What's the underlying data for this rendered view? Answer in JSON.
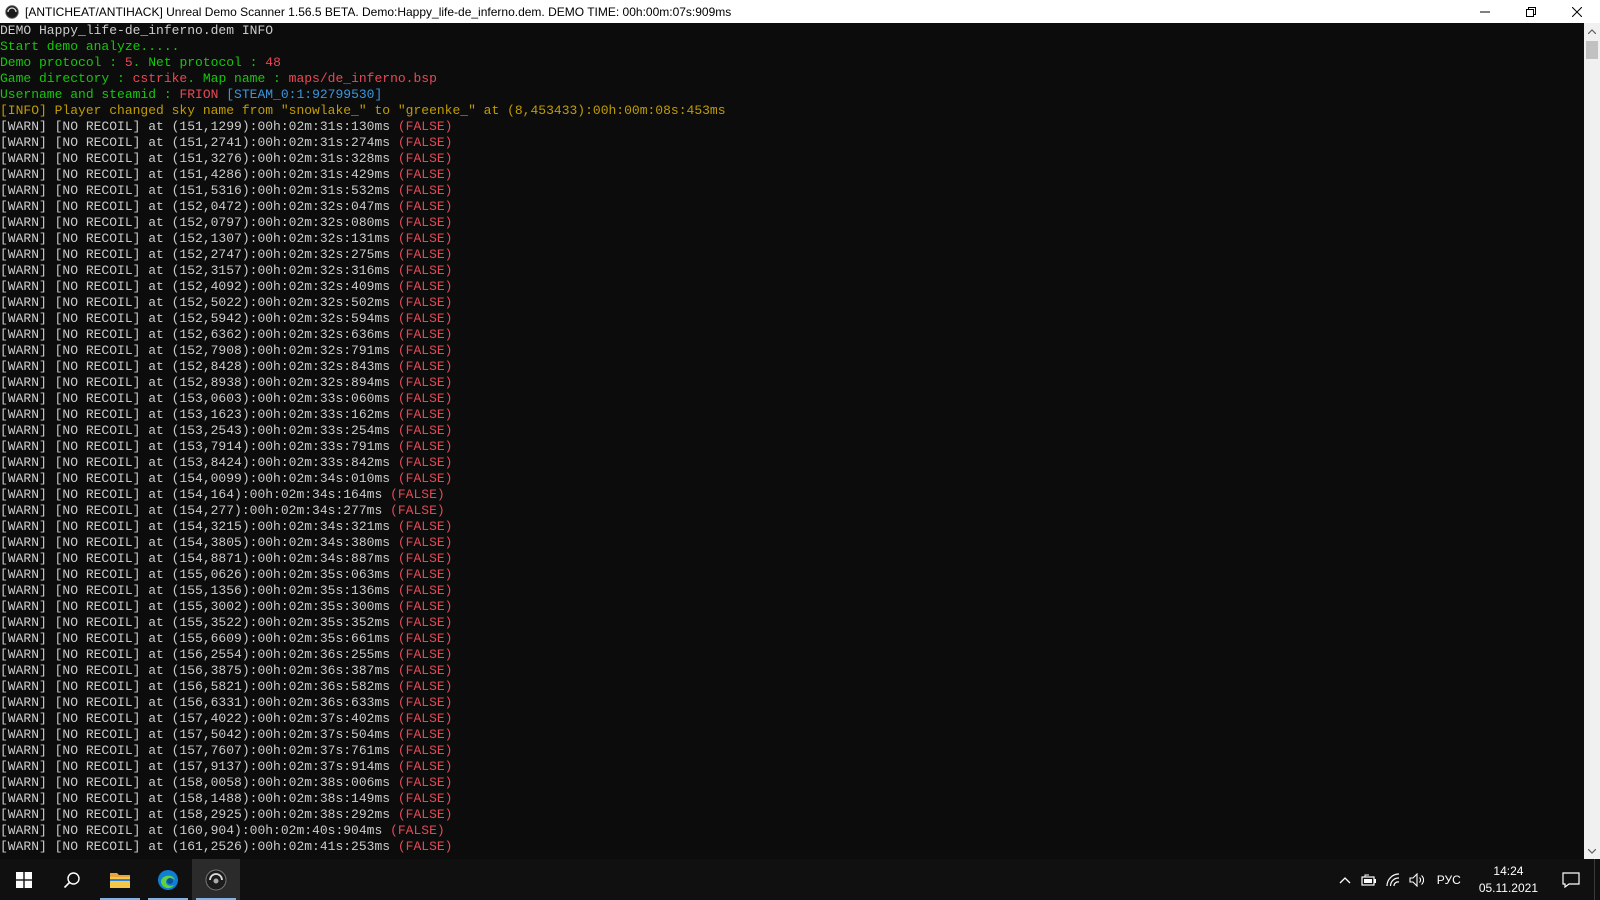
{
  "window": {
    "title": "[ANTICHEAT/ANTIHACK] Unreal Demo Scanner 1.56.5 BETA. Demo:Happy_life-de_inferno.dem. DEMO TIME: 00h:00m:07s:909ms"
  },
  "colors": {
    "gray": "#cccccc",
    "green": "#16c60c",
    "red": "#e74856",
    "cyan": "#3a96dd",
    "yellow": "#c19c00",
    "console_bg": "#0c0c0c"
  },
  "console": {
    "lines": [
      [
        {
          "t": "DEMO Happy_life-de_inferno.dem INFO",
          "c": "gray"
        }
      ],
      [
        {
          "t": "Start demo analyze.....",
          "c": "green"
        }
      ],
      [
        {
          "t": "Demo protocol : ",
          "c": "green"
        },
        {
          "t": "5",
          "c": "red"
        },
        {
          "t": ". Net protocol : ",
          "c": "green"
        },
        {
          "t": "48",
          "c": "red"
        }
      ],
      [
        {
          "t": "Game directory : ",
          "c": "green"
        },
        {
          "t": "cstrike",
          "c": "red"
        },
        {
          "t": ". Map name : ",
          "c": "green"
        },
        {
          "t": "maps/de_inferno.bsp",
          "c": "red"
        }
      ],
      [
        {
          "t": "Username and steamid : ",
          "c": "green"
        },
        {
          "t": "FRION",
          "c": "red"
        },
        {
          "t": " [STEAM_0:1:92799530]",
          "c": "cyan"
        }
      ],
      [
        {
          "t": "[INFO] Player changed sky name from \"snowlake_\" to \"greenke_\" at (8,453433):00h:00m:08s:453ms",
          "c": "yellow"
        }
      ],
      [
        {
          "t": "[WARN] [NO RECOIL] at (151,1299):00h:02m:31s:130ms ",
          "c": "gray"
        },
        {
          "t": "(FALSE)",
          "c": "red"
        }
      ],
      [
        {
          "t": "[WARN] [NO RECOIL] at (151,2741):00h:02m:31s:274ms ",
          "c": "gray"
        },
        {
          "t": "(FALSE)",
          "c": "red"
        }
      ],
      [
        {
          "t": "[WARN] [NO RECOIL] at (151,3276):00h:02m:31s:328ms ",
          "c": "gray"
        },
        {
          "t": "(FALSE)",
          "c": "red"
        }
      ],
      [
        {
          "t": "[WARN] [NO RECOIL] at (151,4286):00h:02m:31s:429ms ",
          "c": "gray"
        },
        {
          "t": "(FALSE)",
          "c": "red"
        }
      ],
      [
        {
          "t": "[WARN] [NO RECOIL] at (151,5316):00h:02m:31s:532ms ",
          "c": "gray"
        },
        {
          "t": "(FALSE)",
          "c": "red"
        }
      ],
      [
        {
          "t": "[WARN] [NO RECOIL] at (152,0472):00h:02m:32s:047ms ",
          "c": "gray"
        },
        {
          "t": "(FALSE)",
          "c": "red"
        }
      ],
      [
        {
          "t": "[WARN] [NO RECOIL] at (152,0797):00h:02m:32s:080ms ",
          "c": "gray"
        },
        {
          "t": "(FALSE)",
          "c": "red"
        }
      ],
      [
        {
          "t": "[WARN] [NO RECOIL] at (152,1307):00h:02m:32s:131ms ",
          "c": "gray"
        },
        {
          "t": "(FALSE)",
          "c": "red"
        }
      ],
      [
        {
          "t": "[WARN] [NO RECOIL] at (152,2747):00h:02m:32s:275ms ",
          "c": "gray"
        },
        {
          "t": "(FALSE)",
          "c": "red"
        }
      ],
      [
        {
          "t": "[WARN] [NO RECOIL] at (152,3157):00h:02m:32s:316ms ",
          "c": "gray"
        },
        {
          "t": "(FALSE)",
          "c": "red"
        }
      ],
      [
        {
          "t": "[WARN] [NO RECOIL] at (152,4092):00h:02m:32s:409ms ",
          "c": "gray"
        },
        {
          "t": "(FALSE)",
          "c": "red"
        }
      ],
      [
        {
          "t": "[WARN] [NO RECOIL] at (152,5022):00h:02m:32s:502ms ",
          "c": "gray"
        },
        {
          "t": "(FALSE)",
          "c": "red"
        }
      ],
      [
        {
          "t": "[WARN] [NO RECOIL] at (152,5942):00h:02m:32s:594ms ",
          "c": "gray"
        },
        {
          "t": "(FALSE)",
          "c": "red"
        }
      ],
      [
        {
          "t": "[WARN] [NO RECOIL] at (152,6362):00h:02m:32s:636ms ",
          "c": "gray"
        },
        {
          "t": "(FALSE)",
          "c": "red"
        }
      ],
      [
        {
          "t": "[WARN] [NO RECOIL] at (152,7908):00h:02m:32s:791ms ",
          "c": "gray"
        },
        {
          "t": "(FALSE)",
          "c": "red"
        }
      ],
      [
        {
          "t": "[WARN] [NO RECOIL] at (152,8428):00h:02m:32s:843ms ",
          "c": "gray"
        },
        {
          "t": "(FALSE)",
          "c": "red"
        }
      ],
      [
        {
          "t": "[WARN] [NO RECOIL] at (152,8938):00h:02m:32s:894ms ",
          "c": "gray"
        },
        {
          "t": "(FALSE)",
          "c": "red"
        }
      ],
      [
        {
          "t": "[WARN] [NO RECOIL] at (153,0603):00h:02m:33s:060ms ",
          "c": "gray"
        },
        {
          "t": "(FALSE)",
          "c": "red"
        }
      ],
      [
        {
          "t": "[WARN] [NO RECOIL] at (153,1623):00h:02m:33s:162ms ",
          "c": "gray"
        },
        {
          "t": "(FALSE)",
          "c": "red"
        }
      ],
      [
        {
          "t": "[WARN] [NO RECOIL] at (153,2543):00h:02m:33s:254ms ",
          "c": "gray"
        },
        {
          "t": "(FALSE)",
          "c": "red"
        }
      ],
      [
        {
          "t": "[WARN] [NO RECOIL] at (153,7914):00h:02m:33s:791ms ",
          "c": "gray"
        },
        {
          "t": "(FALSE)",
          "c": "red"
        }
      ],
      [
        {
          "t": "[WARN] [NO RECOIL] at (153,8424):00h:02m:33s:842ms ",
          "c": "gray"
        },
        {
          "t": "(FALSE)",
          "c": "red"
        }
      ],
      [
        {
          "t": "[WARN] [NO RECOIL] at (154,0099):00h:02m:34s:010ms ",
          "c": "gray"
        },
        {
          "t": "(FALSE)",
          "c": "red"
        }
      ],
      [
        {
          "t": "[WARN] [NO RECOIL] at (154,164):00h:02m:34s:164ms ",
          "c": "gray"
        },
        {
          "t": "(FALSE)",
          "c": "red"
        }
      ],
      [
        {
          "t": "[WARN] [NO RECOIL] at (154,277):00h:02m:34s:277ms ",
          "c": "gray"
        },
        {
          "t": "(FALSE)",
          "c": "red"
        }
      ],
      [
        {
          "t": "[WARN] [NO RECOIL] at (154,3215):00h:02m:34s:321ms ",
          "c": "gray"
        },
        {
          "t": "(FALSE)",
          "c": "red"
        }
      ],
      [
        {
          "t": "[WARN] [NO RECOIL] at (154,3805):00h:02m:34s:380ms ",
          "c": "gray"
        },
        {
          "t": "(FALSE)",
          "c": "red"
        }
      ],
      [
        {
          "t": "[WARN] [NO RECOIL] at (154,8871):00h:02m:34s:887ms ",
          "c": "gray"
        },
        {
          "t": "(FALSE)",
          "c": "red"
        }
      ],
      [
        {
          "t": "[WARN] [NO RECOIL] at (155,0626):00h:02m:35s:063ms ",
          "c": "gray"
        },
        {
          "t": "(FALSE)",
          "c": "red"
        }
      ],
      [
        {
          "t": "[WARN] [NO RECOIL] at (155,1356):00h:02m:35s:136ms ",
          "c": "gray"
        },
        {
          "t": "(FALSE)",
          "c": "red"
        }
      ],
      [
        {
          "t": "[WARN] [NO RECOIL] at (155,3002):00h:02m:35s:300ms ",
          "c": "gray"
        },
        {
          "t": "(FALSE)",
          "c": "red"
        }
      ],
      [
        {
          "t": "[WARN] [NO RECOIL] at (155,3522):00h:02m:35s:352ms ",
          "c": "gray"
        },
        {
          "t": "(FALSE)",
          "c": "red"
        }
      ],
      [
        {
          "t": "[WARN] [NO RECOIL] at (155,6609):00h:02m:35s:661ms ",
          "c": "gray"
        },
        {
          "t": "(FALSE)",
          "c": "red"
        }
      ],
      [
        {
          "t": "[WARN] [NO RECOIL] at (156,2554):00h:02m:36s:255ms ",
          "c": "gray"
        },
        {
          "t": "(FALSE)",
          "c": "red"
        }
      ],
      [
        {
          "t": "[WARN] [NO RECOIL] at (156,3875):00h:02m:36s:387ms ",
          "c": "gray"
        },
        {
          "t": "(FALSE)",
          "c": "red"
        }
      ],
      [
        {
          "t": "[WARN] [NO RECOIL] at (156,5821):00h:02m:36s:582ms ",
          "c": "gray"
        },
        {
          "t": "(FALSE)",
          "c": "red"
        }
      ],
      [
        {
          "t": "[WARN] [NO RECOIL] at (156,6331):00h:02m:36s:633ms ",
          "c": "gray"
        },
        {
          "t": "(FALSE)",
          "c": "red"
        }
      ],
      [
        {
          "t": "[WARN] [NO RECOIL] at (157,4022):00h:02m:37s:402ms ",
          "c": "gray"
        },
        {
          "t": "(FALSE)",
          "c": "red"
        }
      ],
      [
        {
          "t": "[WARN] [NO RECOIL] at (157,5042):00h:02m:37s:504ms ",
          "c": "gray"
        },
        {
          "t": "(FALSE)",
          "c": "red"
        }
      ],
      [
        {
          "t": "[WARN] [NO RECOIL] at (157,7607):00h:02m:37s:761ms ",
          "c": "gray"
        },
        {
          "t": "(FALSE)",
          "c": "red"
        }
      ],
      [
        {
          "t": "[WARN] [NO RECOIL] at (157,9137):00h:02m:37s:914ms ",
          "c": "gray"
        },
        {
          "t": "(FALSE)",
          "c": "red"
        }
      ],
      [
        {
          "t": "[WARN] [NO RECOIL] at (158,0058):00h:02m:38s:006ms ",
          "c": "gray"
        },
        {
          "t": "(FALSE)",
          "c": "red"
        }
      ],
      [
        {
          "t": "[WARN] [NO RECOIL] at (158,1488):00h:02m:38s:149ms ",
          "c": "gray"
        },
        {
          "t": "(FALSE)",
          "c": "red"
        }
      ],
      [
        {
          "t": "[WARN] [NO RECOIL] at (158,2925):00h:02m:38s:292ms ",
          "c": "gray"
        },
        {
          "t": "(FALSE)",
          "c": "red"
        }
      ],
      [
        {
          "t": "[WARN] [NO RECOIL] at (160,904):00h:02m:40s:904ms ",
          "c": "gray"
        },
        {
          "t": "(FALSE)",
          "c": "red"
        }
      ],
      [
        {
          "t": "[WARN] [NO RECOIL] at (161,2526):00h:02m:41s:253ms ",
          "c": "gray"
        },
        {
          "t": "(FALSE)",
          "c": "red"
        }
      ]
    ]
  },
  "taskbar": {
    "items": [
      {
        "name": "start-button",
        "icon": "windows-logo-icon"
      },
      {
        "name": "search-button",
        "icon": "search-icon"
      },
      {
        "name": "file-explorer-button",
        "icon": "folder-icon"
      },
      {
        "name": "edge-button",
        "icon": "edge-icon"
      },
      {
        "name": "scanner-app-button",
        "icon": "scanner-app-icon"
      }
    ],
    "tray": {
      "icons": [
        "chevron-up-icon",
        "battery-icon",
        "wifi-icon",
        "volume-icon"
      ],
      "language": "РУС",
      "time": "14:24",
      "date": "05.11.2021"
    }
  }
}
